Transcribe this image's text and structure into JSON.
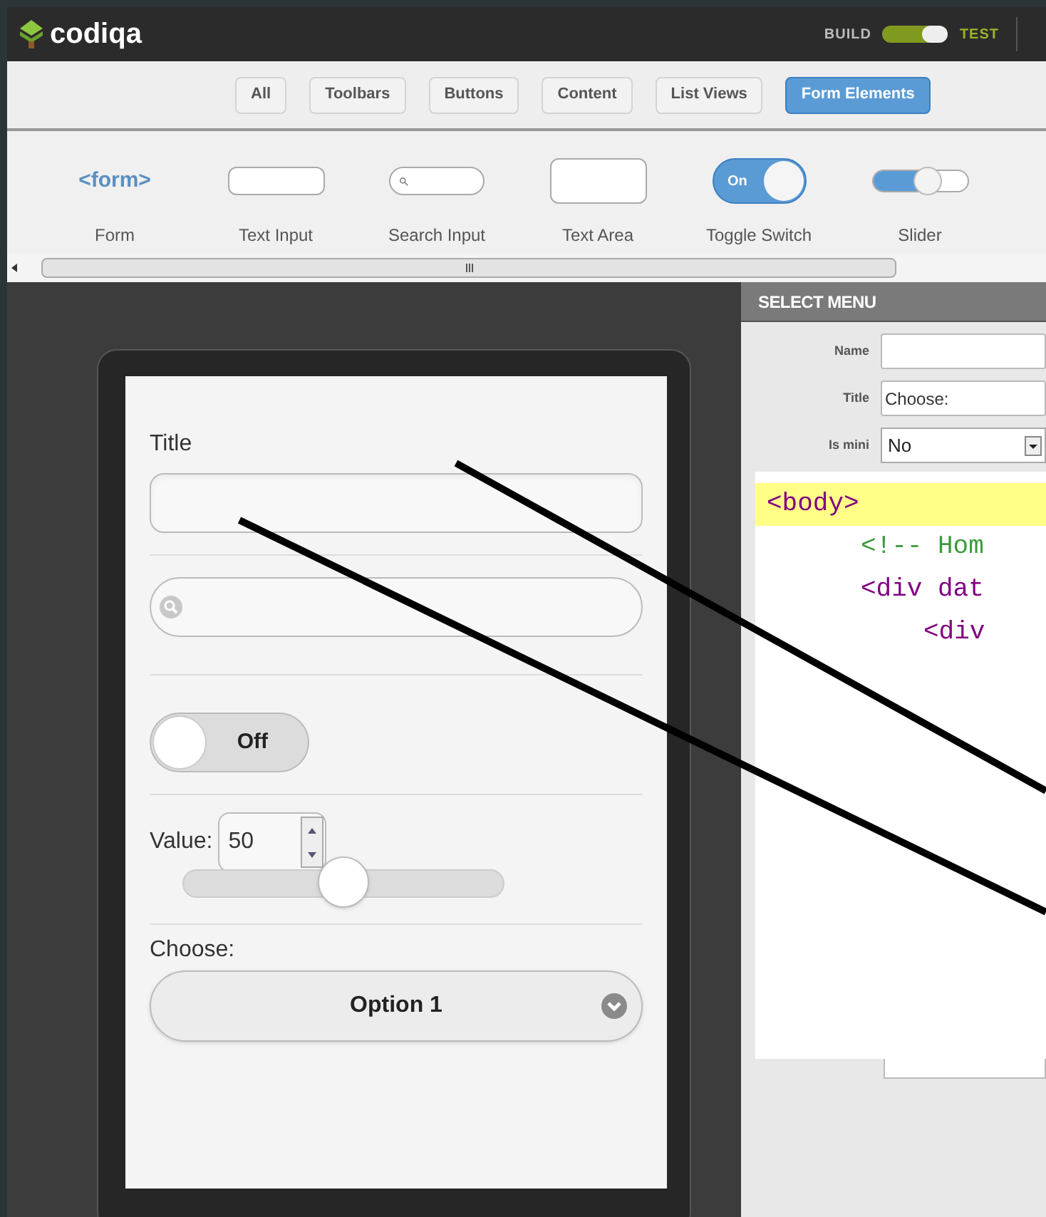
{
  "header": {
    "logo": "codiqa",
    "mode_left": "BUILD",
    "mode_right": "TEST",
    "mode_test_on": true
  },
  "filters": [
    {
      "label": "All",
      "selected": false
    },
    {
      "label": "Toolbars",
      "selected": false
    },
    {
      "label": "Buttons",
      "selected": false
    },
    {
      "label": "Content",
      "selected": false
    },
    {
      "label": "List Views",
      "selected": false
    },
    {
      "label": "Form Elements",
      "selected": true
    }
  ],
  "palette": [
    {
      "kind": "form",
      "preview": "<form>",
      "label": "Form"
    },
    {
      "kind": "text",
      "label": "Text Input"
    },
    {
      "kind": "search",
      "label": "Search Input"
    },
    {
      "kind": "textarea",
      "label": "Text Area"
    },
    {
      "kind": "toggle",
      "preview": "On",
      "label": "Toggle Switch"
    },
    {
      "kind": "slider",
      "label": "Slider"
    }
  ],
  "phone": {
    "title_label": "Title",
    "toggle": {
      "label": "Off",
      "on": false
    },
    "value_label": "Value:",
    "value": "50",
    "slider": {
      "level": 0.5
    },
    "select_label": "Choose:",
    "select_value": "Option 1"
  },
  "properties": {
    "title": "SELECT MENU",
    "fields": [
      {
        "kind": "input",
        "label": "Name"
      },
      {
        "kind": "input",
        "label": "Title",
        "value": "Choose:"
      },
      {
        "kind": "select",
        "label": "Is mini",
        "value": "No"
      }
    ]
  },
  "code": [
    {
      "text": "<body>",
      "highlighted": true,
      "color": "#800080"
    },
    {
      "text": "<!-- Hom",
      "highlighted": false,
      "color": "#3c9a3c"
    },
    {
      "text": "<div dat",
      "highlighted": false,
      "color": "#800080"
    },
    {
      "text": "<div",
      "highlighted": false,
      "color": "#800080"
    }
  ]
}
